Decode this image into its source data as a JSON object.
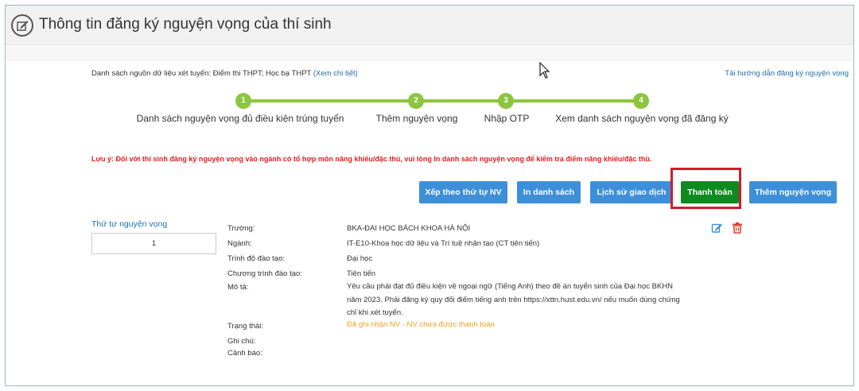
{
  "page": {
    "title": "Thông tin đăng ký nguyện vọng của thí sinh"
  },
  "source": {
    "text": "Danh sách nguồn dữ liệu xét tuyển: Điểm thi THPT; Học bạ THPT",
    "link": "(Xem chi tiết)"
  },
  "guide_link": "Tải hướng dẫn đăng ký nguyện vọng",
  "steps": [
    {
      "num": "1",
      "label": "Danh sách nguyện vọng đủ điều kiện trúng tuyển"
    },
    {
      "num": "2",
      "label": "Thêm nguyện vọng"
    },
    {
      "num": "3",
      "label": "Nhập OTP"
    },
    {
      "num": "4",
      "label": "Xem danh sách nguyện vọng đã đăng ký"
    }
  ],
  "notice": "Lưu ý: Đối với thí sinh đăng ký nguyện vọng vào ngành có tổ hợp môn năng khiếu/đặc thù, vui lòng In danh sách nguyện vọng để kiểm tra điểm năng khiếu/đặc thù.",
  "toolbar": {
    "sort": "Xếp theo thứ tự NV",
    "print": "In danh sách",
    "history": "Lịch sử giao dịch",
    "pay": "Thanh toán",
    "add": "Thêm nguyện vọng"
  },
  "order": {
    "label": "Thứ tự nguyện vọng",
    "value": "1"
  },
  "details": {
    "school_label": "Trường:",
    "school": "BKA-ĐẠI HỌC BÁCH KHOA HÀ NỘI",
    "major_label": "Ngành:",
    "major": "IT-E10-Khoa học dữ liệu và Trí tuệ nhân tạo (CT tiên tiến)",
    "level_label": "Trình độ đào tạo:",
    "level": "Đại học",
    "program_label": "Chương trình đào tạo:",
    "program": "Tiên tiến",
    "desc_label": "Mô tả:",
    "desc": "Yêu cầu phải đạt đủ điều kiện về ngoại ngữ (Tiếng Anh) theo đề án tuyển sinh của Đại học BKHN năm 2023. Phải đăng ký quy đổi điểm tiếng anh trên https://xttn.hust.edu.vn/ nếu muốn dùng chứng chỉ khi xét tuyển.",
    "status_label": "Trạng thái:",
    "status": "Đã ghi nhận NV - NV chưa được thanh toán",
    "note_label": "Ghi chú:",
    "warning_label": "Cảnh báo:"
  },
  "icons": {
    "title": "edit-circle-icon",
    "edit": "edit-icon",
    "delete": "trash-icon"
  },
  "colors": {
    "step": "#8cc63f",
    "button": "#3d8fd9",
    "pay_button": "#0f8a1f",
    "highlight": "#d01d2a",
    "notice": "#e02020",
    "status": "#f0a020",
    "link": "#1f6fb5"
  }
}
